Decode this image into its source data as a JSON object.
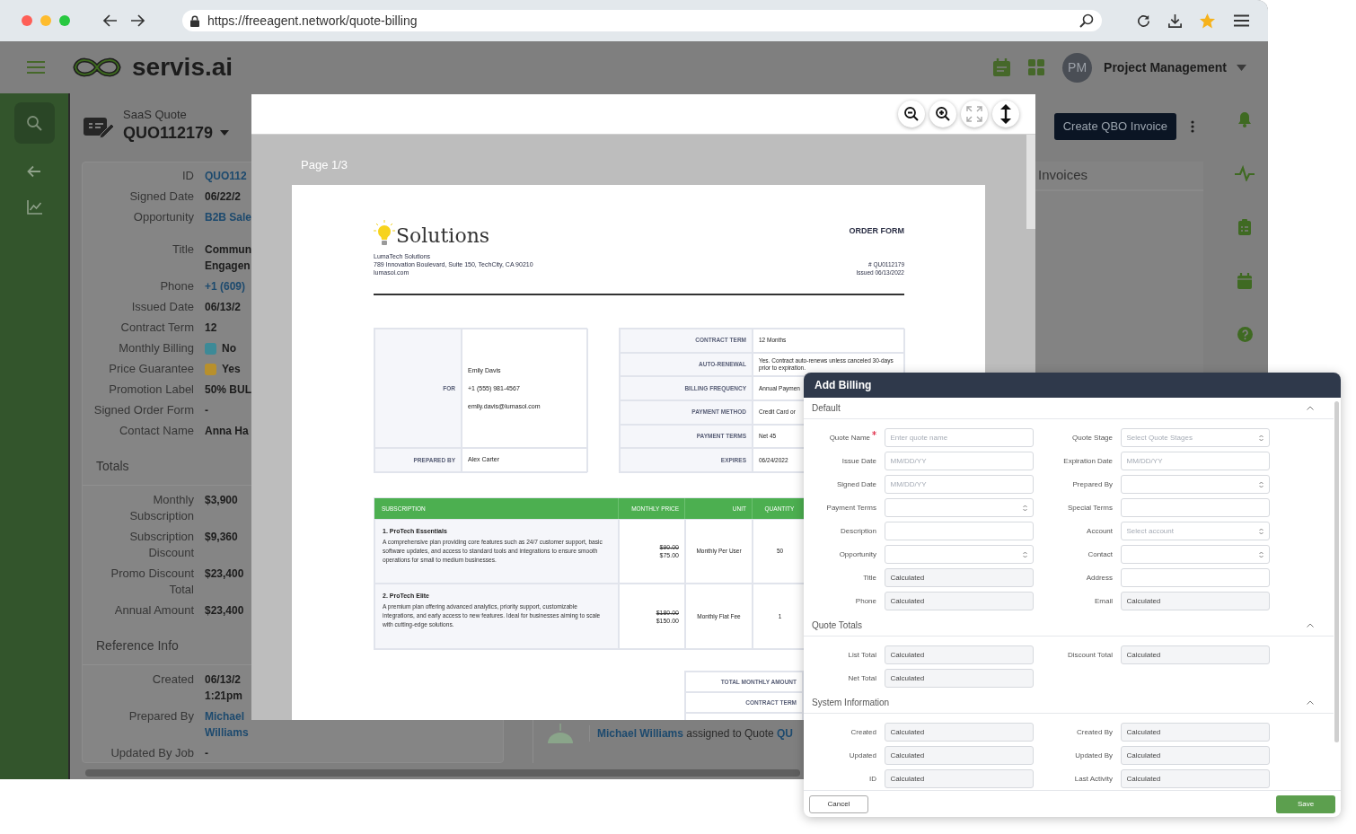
{
  "browser": {
    "url": "https://freeagent.network/quote-billing"
  },
  "header": {
    "brand": "servis.ai",
    "avatar": "PM",
    "user": "Project Management"
  },
  "record": {
    "type": "SaaS Quote",
    "number": "QUO112179",
    "field_groups": [
      [
        {
          "label": "ID",
          "value": "QUO112",
          "kind": "link"
        },
        {
          "label": "Signed Date",
          "value": "06/22/2",
          "kind": "text"
        },
        {
          "label": "Opportunity",
          "value": "B2B Sale",
          "kind": "link"
        }
      ],
      [
        {
          "label": "Title",
          "value": "Commun\nEngagen",
          "kind": "text"
        },
        {
          "label": "Phone",
          "value": "+1 (609)",
          "kind": "link"
        },
        {
          "label": "Issued Date",
          "value": "06/13/2",
          "kind": "text"
        },
        {
          "label": "Contract Term",
          "value": "12",
          "kind": "text"
        },
        {
          "label": "Monthly Billing",
          "value": "No",
          "kind": "tag",
          "color": "#3d8a97"
        },
        {
          "label": "Price Guarantee",
          "value": "Yes",
          "kind": "tag",
          "color": "#b8902c"
        },
        {
          "label": "Promotion Label",
          "value": "50% BUL",
          "kind": "text"
        },
        {
          "label": "Signed Order Form",
          "value": "-",
          "kind": "text"
        },
        {
          "label": "Contact Name",
          "value": "Anna Ha",
          "kind": "text"
        }
      ]
    ],
    "sections": [
      {
        "title": "Totals",
        "fields": [
          {
            "label": "Monthly Subscription",
            "value": "$3,900",
            "kind": "text"
          },
          {
            "label": "Subscription Discount",
            "value": "$9,360",
            "kind": "text"
          },
          {
            "label": "Promo Discount Total",
            "value": "$23,400",
            "kind": "text"
          },
          {
            "label": "Annual Amount",
            "value": "$23,400",
            "kind": "text"
          }
        ]
      },
      {
        "title": "Reference Info",
        "fields": [
          {
            "label": "Created",
            "value": "06/13/2\n1:21pm",
            "kind": "text"
          },
          {
            "label": "Prepared By",
            "value": "Michael\nWilliams",
            "kind": "link"
          },
          {
            "label": "Updated By Job",
            "value": "-",
            "kind": "text"
          }
        ]
      }
    ]
  },
  "actions": {
    "create_invoice": "Create QBO Invoice"
  },
  "invoices": {
    "title": "Invoices"
  },
  "activity": {
    "actor": "Michael Williams",
    "action": "assigned to Quote",
    "target": "QU"
  },
  "pdf_viewer": {
    "page_indicator": "Page 1/3",
    "document": {
      "brand": "Solutions",
      "company_lines": [
        "LumaTech Solutions",
        "789 Innovation Boulevard, Suite 150, TechCity, CA 90210",
        "lumasol.com"
      ],
      "heading": "ORDER FORM",
      "number": "# QU0112179",
      "issued": "Issued 06/13/2022",
      "customer": {
        "label": "FOR",
        "lines": [
          "Emily Davis",
          "+1 (555) 981-4567",
          "emily.davis@lumasol.com"
        ]
      },
      "prepared_by": {
        "label": "PREPARED BY",
        "value": "Alex Carter"
      },
      "terms": [
        {
          "label": "CONTRACT TERM",
          "value": "12 Months"
        },
        {
          "label": "AUTO-RENEWAL",
          "value": "Yes. Contract auto-renews unless canceled 30-days prior to expiration."
        },
        {
          "label": "BILLING FREQUENCY",
          "value": "Annual Paymen"
        },
        {
          "label": "PAYMENT METHOD",
          "value": "Credit Card or"
        },
        {
          "label": "PAYMENT TERMS",
          "value": "Net 45"
        },
        {
          "label": "EXPIRES",
          "value": "06/24/2022"
        }
      ],
      "items_table": {
        "columns": [
          "SUBSCRIPTION",
          "MONTHLY PRICE",
          "UNIT",
          "QUANTITY"
        ],
        "rows": [
          {
            "name": "1. ProTech Essentials",
            "description": "A comprehensive plan providing core features such as 24/7 customer support, basic software updates, and access to standard tools and integrations to ensure smooth operations for small to medium businesses.",
            "list_price": "$90.00",
            "price": "$75.00",
            "unit": "Monthly Per User",
            "quantity": "50"
          },
          {
            "name": "2. ProTech Elite",
            "description": "A premium plan offering advanced analytics, priority support, customizable integrations, and early access to new features. Ideal for businesses aiming to scale with cutting-edge solutions.",
            "list_price": "$180.00",
            "price": "$150.00",
            "unit": "Monthly Flat Fee",
            "quantity": "1"
          }
        ]
      },
      "totals": [
        "TOTAL MONTHLY AMOUNT",
        "CONTRACT TERM"
      ]
    }
  },
  "dialog": {
    "title": "Add Billing",
    "sections": [
      {
        "title": "Default",
        "expanded": true,
        "fields": [
          {
            "label": "Quote Name",
            "kind": "text",
            "placeholder": "Enter quote name",
            "required": true
          },
          {
            "label": "Quote Stage",
            "kind": "select",
            "placeholder": "Select Quote Stages",
            "required": false
          },
          {
            "label": "Issue Date",
            "kind": "text",
            "placeholder": "MM/DD/YY",
            "required": false
          },
          {
            "label": "Expiration Date",
            "kind": "text",
            "placeholder": "MM/DD/YY",
            "required": false
          },
          {
            "label": "Signed Date",
            "kind": "text",
            "placeholder": "MM/DD/YY",
            "required": false
          },
          {
            "label": "Prepared By",
            "kind": "select",
            "required": false
          },
          {
            "label": "Payment Terms",
            "kind": "select",
            "required": false
          },
          {
            "label": "Special Terms",
            "kind": "text",
            "required": false
          },
          {
            "label": "Description",
            "kind": "text",
            "required": false
          },
          {
            "label": "Account",
            "kind": "select",
            "placeholder": "Select account",
            "required": false
          },
          {
            "label": "Opportunity",
            "kind": "select",
            "required": false
          },
          {
            "label": "Contact",
            "kind": "select",
            "required": false
          },
          {
            "label": "Title",
            "kind": "calculated",
            "value": "Calculated",
            "required": false
          },
          {
            "label": "Address",
            "kind": "text",
            "required": false
          },
          {
            "label": "Phone",
            "kind": "calculated",
            "value": "Calculated",
            "required": false
          },
          {
            "label": "Email",
            "kind": "calculated",
            "value": "Calculated",
            "required": false
          }
        ]
      },
      {
        "title": "Quote Totals",
        "expanded": true,
        "fields": [
          {
            "label": "List Total",
            "kind": "calculated",
            "value": "Calculated",
            "required": false
          },
          {
            "label": "Discount Total",
            "kind": "calculated",
            "value": "Calculated",
            "required": false
          },
          {
            "label": "Net Total",
            "kind": "calculated",
            "value": "Calculated",
            "required": false
          }
        ]
      },
      {
        "title": "System Information",
        "expanded": true,
        "fields": [
          {
            "label": "Created",
            "kind": "calculated",
            "value": "Calculated",
            "required": false
          },
          {
            "label": "Created By",
            "kind": "calculated",
            "value": "Calculated",
            "required": false
          },
          {
            "label": "Updated",
            "kind": "calculated",
            "value": "Calculated",
            "required": false
          },
          {
            "label": "Updated By",
            "kind": "calculated",
            "value": "Calculated",
            "required": false
          },
          {
            "label": "ID",
            "kind": "calculated",
            "value": "Calculated",
            "required": false
          },
          {
            "label": "Last Activity",
            "kind": "calculated",
            "value": "Calculated",
            "required": false
          }
        ]
      }
    ],
    "cancel": "Cancel",
    "save": "Save"
  }
}
